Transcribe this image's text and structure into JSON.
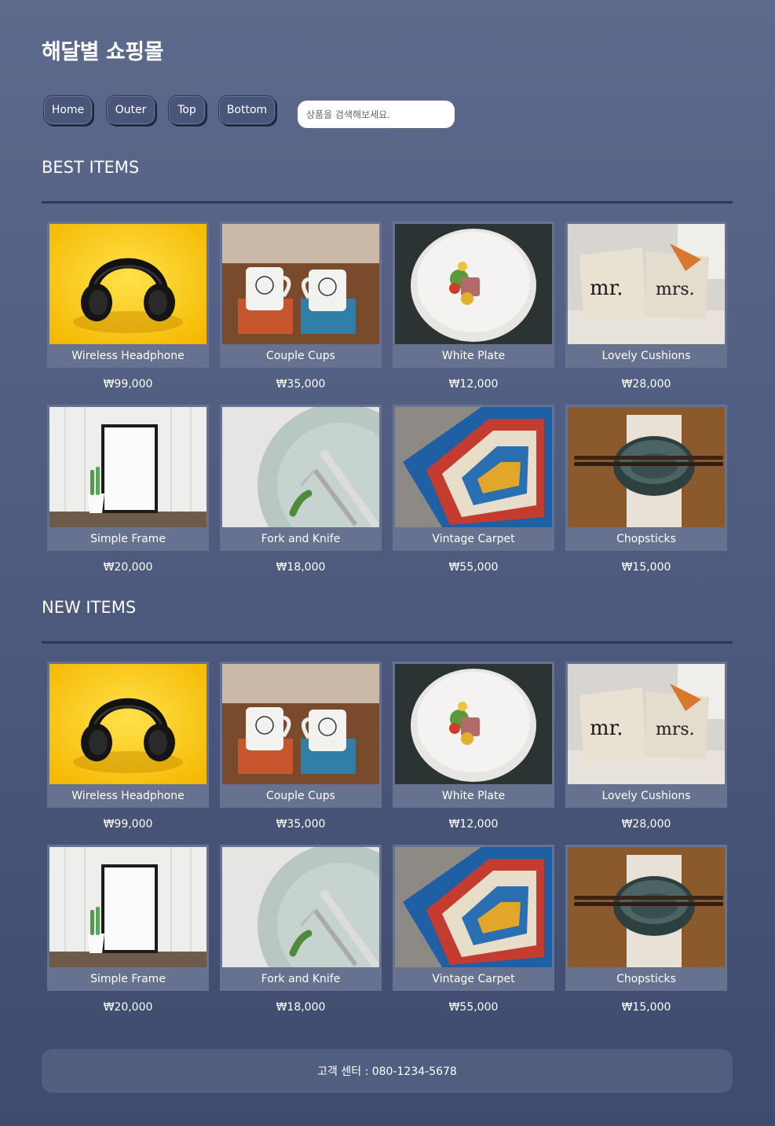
{
  "site": {
    "title": "해달별 쇼핑몰"
  },
  "nav": {
    "buttons": [
      "Home",
      "Outer",
      "Top",
      "Bottom"
    ],
    "search_placeholder": "상품을 검색해보세요."
  },
  "sections": [
    {
      "title": "BEST ITEMS",
      "products": [
        {
          "name": "Wireless Headphone",
          "price": "₩99,000",
          "image": "headphone-image"
        },
        {
          "name": "Couple Cups",
          "price": "₩35,000",
          "image": "cups-image"
        },
        {
          "name": "White Plate",
          "price": "₩12,000",
          "image": "plate-image"
        },
        {
          "name": "Lovely Cushions",
          "price": "₩28,000",
          "image": "cushions-image"
        },
        {
          "name": "Simple Frame",
          "price": "₩20,000",
          "image": "frame-image"
        },
        {
          "name": "Fork and Knife",
          "price": "₩18,000",
          "image": "cutlery-image"
        },
        {
          "name": "Vintage Carpet",
          "price": "₩55,000",
          "image": "carpet-image"
        },
        {
          "name": "Chopsticks",
          "price": "₩15,000",
          "image": "chopsticks-image"
        }
      ]
    },
    {
      "title": "NEW ITEMS",
      "products": [
        {
          "name": "Wireless Headphone",
          "price": "₩99,000",
          "image": "headphone-image"
        },
        {
          "name": "Couple Cups",
          "price": "₩35,000",
          "image": "cups-image"
        },
        {
          "name": "White Plate",
          "price": "₩12,000",
          "image": "plate-image"
        },
        {
          "name": "Lovely Cushions",
          "price": "₩28,000",
          "image": "cushions-image"
        },
        {
          "name": "Simple Frame",
          "price": "₩20,000",
          "image": "frame-image"
        },
        {
          "name": "Fork and Knife",
          "price": "₩18,000",
          "image": "cutlery-image"
        },
        {
          "name": "Vintage Carpet",
          "price": "₩55,000",
          "image": "carpet-image"
        },
        {
          "name": "Chopsticks",
          "price": "₩15,000",
          "image": "chopsticks-image"
        }
      ]
    }
  ],
  "footer": {
    "text": "고객 센터 : 080-1234-5678"
  }
}
